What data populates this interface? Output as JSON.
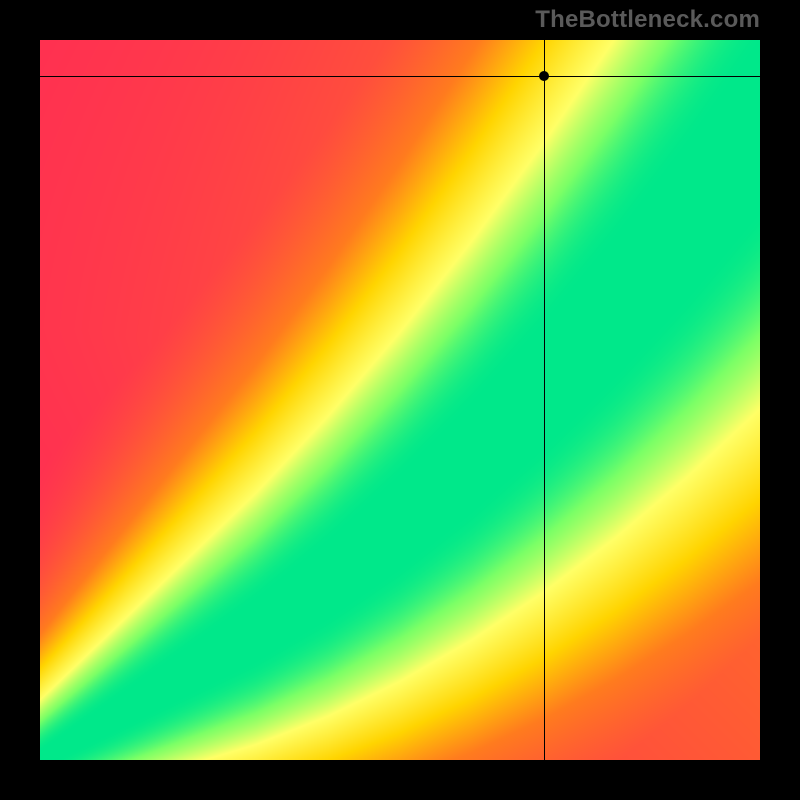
{
  "watermark": {
    "text": "TheBottleneck.com"
  },
  "chart_data": {
    "type": "heatmap",
    "title": "",
    "xlabel": "",
    "ylabel": "",
    "xlim": [
      0,
      100
    ],
    "ylim": [
      0,
      100
    ],
    "marker": {
      "x": 70,
      "y": 95
    },
    "crosshair": {
      "x": 70,
      "y": 95
    },
    "field_description": "Scalar field over x (0-100) and y (0-100, origin bottom-left). Value 0 = worst (red), 1 = best (green). A diagonal ridge of high values runs from the lower-left corner toward the upper-right, widening with x/y, indicating balanced pairings.",
    "colorscale": [
      {
        "v": 0.0,
        "hex": "#ff2a55"
      },
      {
        "v": 0.4,
        "hex": "#ff7b1e"
      },
      {
        "v": 0.6,
        "hex": "#ffd400"
      },
      {
        "v": 0.8,
        "hex": "#ffff66"
      },
      {
        "v": 0.92,
        "hex": "#7bff66"
      },
      {
        "v": 1.0,
        "hex": "#00e88a"
      }
    ],
    "ridge_samples": [
      {
        "x": 0,
        "y_center": 0,
        "half_width": 1
      },
      {
        "x": 10,
        "y_center": 6,
        "half_width": 2
      },
      {
        "x": 20,
        "y_center": 12,
        "half_width": 3
      },
      {
        "x": 30,
        "y_center": 18,
        "half_width": 4
      },
      {
        "x": 40,
        "y_center": 25,
        "half_width": 5
      },
      {
        "x": 50,
        "y_center": 33,
        "half_width": 6
      },
      {
        "x": 60,
        "y_center": 42,
        "half_width": 7
      },
      {
        "x": 70,
        "y_center": 52,
        "half_width": 8
      },
      {
        "x": 80,
        "y_center": 63,
        "half_width": 9
      },
      {
        "x": 90,
        "y_center": 75,
        "half_width": 10
      },
      {
        "x": 100,
        "y_center": 88,
        "half_width": 11
      }
    ],
    "grid": false,
    "legend": false
  }
}
